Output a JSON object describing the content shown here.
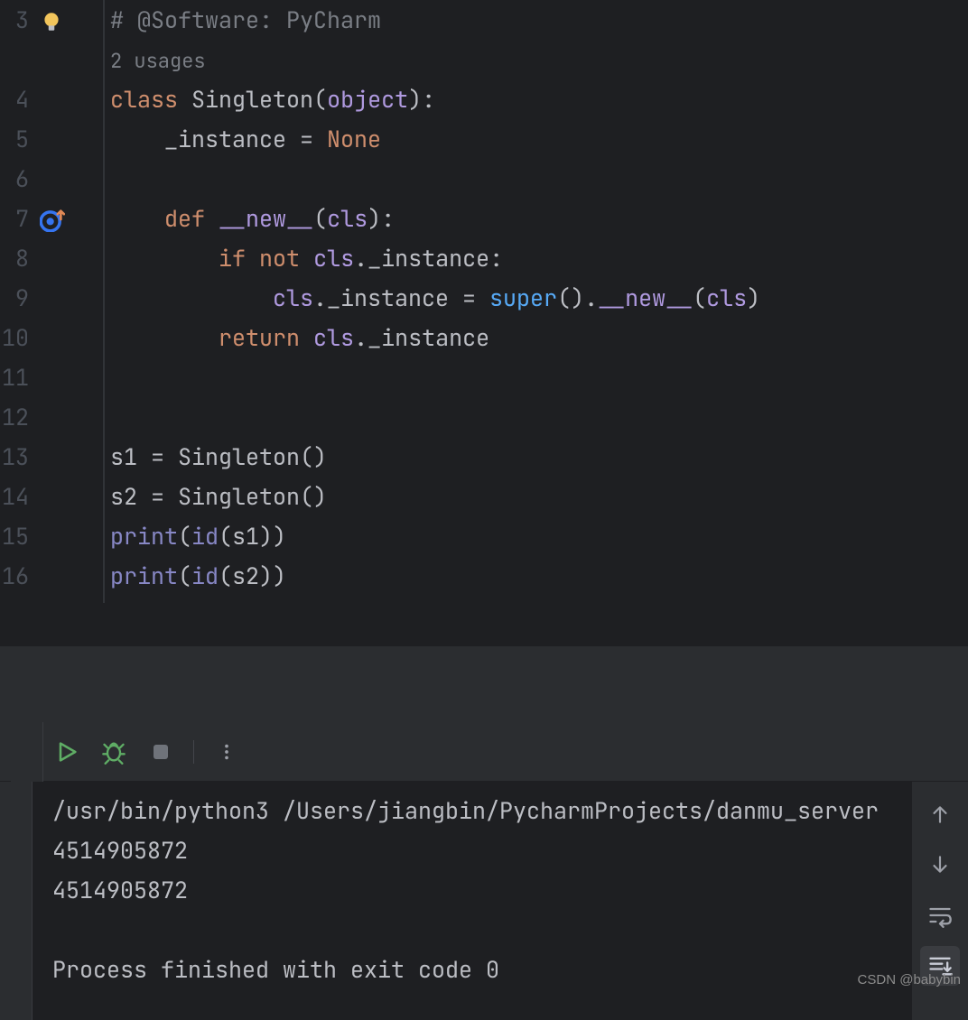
{
  "gutter": {
    "lines": [
      "3",
      "4",
      "5",
      "6",
      "7",
      "8",
      "9",
      "10",
      "11",
      "12",
      "13",
      "14",
      "15",
      "16"
    ],
    "usages_label": "2 usages",
    "override_icon": "override-up-icon",
    "bulb_icon": "intention-bulb-icon"
  },
  "code": {
    "l3_comment_pre": "# @Software: ",
    "l3_comment_val": "PyCharm",
    "l4_kw_class": "class",
    "l4_name": "Singleton",
    "l4_paren_o": "(",
    "l4_obj": "object",
    "l4_paren_c": "):",
    "l5_indent": "    ",
    "l5_field": "_instance",
    "l5_eq": " = ",
    "l5_none": "None",
    "l7_indent": "    ",
    "l7_def": "def",
    "l7_sp": " ",
    "l7_new": "__new__",
    "l7_po": "(",
    "l7_cls": "cls",
    "l7_pc": "):",
    "l8_indent": "        ",
    "l8_if": "if",
    "l8_sp": " ",
    "l8_not": "not",
    "l8_sp2": " ",
    "l8_cls": "cls",
    "l8_tail": "._instance:",
    "l9_indent": "            ",
    "l9_cls": "cls",
    "l9_mid": "._instance = ",
    "l9_super": "super",
    "l9_call": "().",
    "l9_new": "__new__",
    "l9_po": "(",
    "l9_cls2": "cls",
    "l9_pc": ")",
    "l10_indent": "        ",
    "l10_ret": "return",
    "l10_sp": " ",
    "l10_cls": "cls",
    "l10_tail": "._instance",
    "l13": "s1 = Singleton()",
    "l14": "s2 = Singleton()",
    "l15_print": "print",
    "l15_po": "(",
    "l15_id": "id",
    "l15_tail": "(s1))",
    "l16_print": "print",
    "l16_po": "(",
    "l16_id": "id",
    "l16_tail": "(s2))"
  },
  "toolbar": {
    "run": "run-icon",
    "debug": "debug-icon",
    "stop": "stop-icon",
    "more": "more-icon"
  },
  "console": {
    "line1": "/usr/bin/python3 /Users/jiangbin/PycharmProjects/danmu_server",
    "line2": "4514905872",
    "line3": "4514905872",
    "line4": "",
    "line5": "Process finished with exit code 0",
    "nav_up": "arrow-up-icon",
    "nav_down": "arrow-down-icon",
    "soft_wrap": "soft-wrap-icon",
    "scroll_end": "scroll-to-end-icon"
  },
  "watermark": "CSDN @babybin"
}
